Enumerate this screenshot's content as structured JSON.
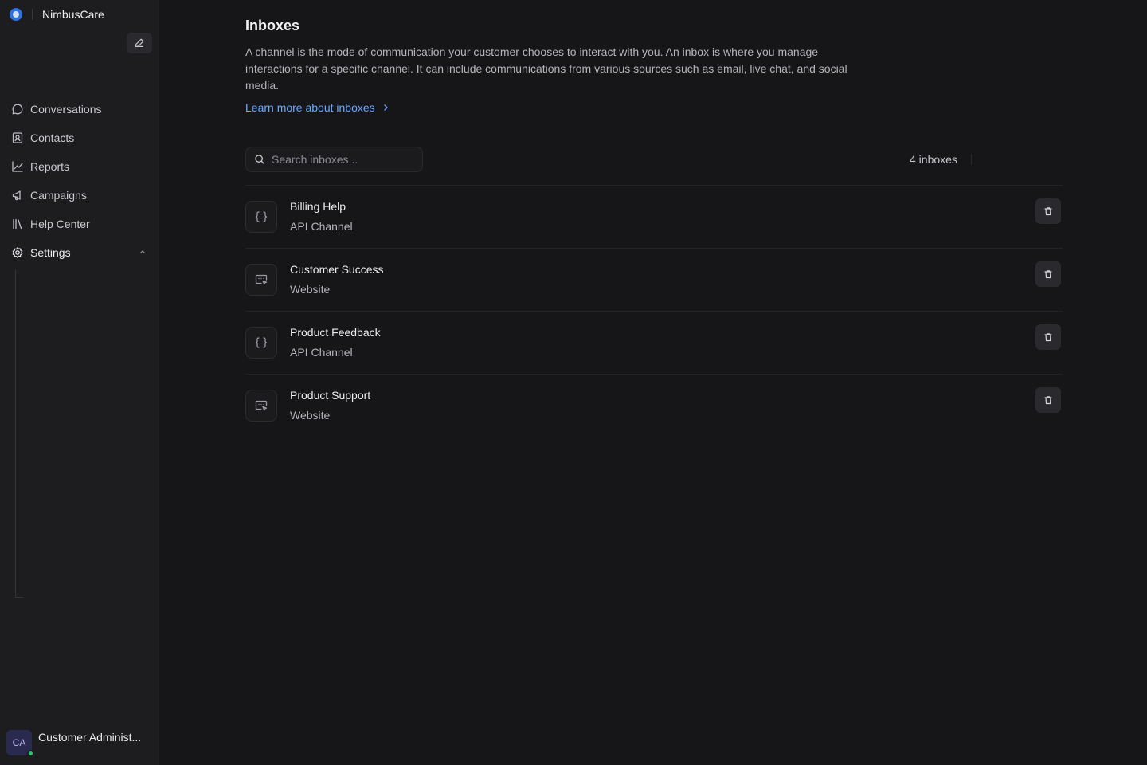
{
  "app": {
    "name": "NimbusCare",
    "brand_color": "#2b6fe0",
    "link_color": "#6aa8ff"
  },
  "sidebar": {
    "compose_icon": "edit-icon",
    "items": [
      {
        "label": "Conversations",
        "icon": "chat-bubble-icon"
      },
      {
        "label": "Contacts",
        "icon": "contact-card-icon"
      },
      {
        "label": "Reports",
        "icon": "line-chart-icon"
      },
      {
        "label": "Campaigns",
        "icon": "megaphone-icon"
      },
      {
        "label": "Help Center",
        "icon": "library-icon"
      },
      {
        "label": "Settings",
        "icon": "settings-icon",
        "expanded": true
      }
    ],
    "user": {
      "initials": "CA",
      "name": "Customer Administ...",
      "status": "online"
    }
  },
  "main": {
    "title": "Inboxes",
    "description": "A channel is the mode of communication your customer chooses to interact with you. An inbox is where you manage interactions for a specific channel. It can include communications from various sources such as email, live chat, and social media.",
    "learn_more": "Learn more about inboxes",
    "search": {
      "placeholder": "Search inboxes...",
      "value": ""
    },
    "count": "4 inboxes",
    "inboxes": [
      {
        "name": "Billing Help",
        "type": "API Channel",
        "icon": "code-braces-icon"
      },
      {
        "name": "Customer Success",
        "type": "Website",
        "icon": "website-chat-icon"
      },
      {
        "name": "Product Feedback",
        "type": "API Channel",
        "icon": "code-braces-icon"
      },
      {
        "name": "Product Support",
        "type": "Website",
        "icon": "website-chat-icon"
      }
    ]
  }
}
